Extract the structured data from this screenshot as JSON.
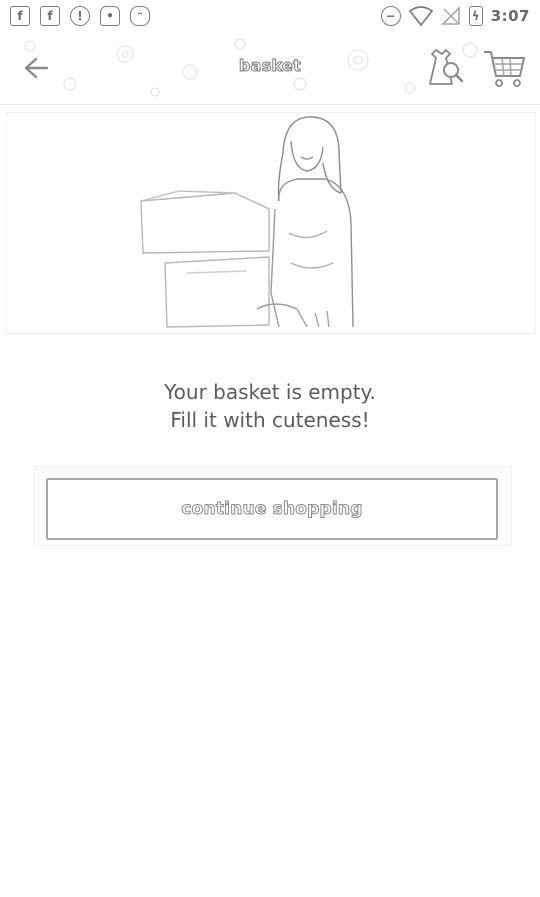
{
  "status_bar": {
    "time": "3:07",
    "icons_left": [
      "facebook-icon",
      "facebook-icon",
      "circle-badge-icon",
      "lock-icon",
      "cat-icon"
    ],
    "icons_right": [
      "do-not-disturb-icon",
      "wifi-icon",
      "no-signal-icon",
      "battery-icon"
    ]
  },
  "header": {
    "title": "basket",
    "back_icon": "arrow-left-icon",
    "search_icon": "dress-search-icon",
    "cart_icon": "shopping-cart-icon"
  },
  "hero": {
    "image": "girl-with-box-illustration"
  },
  "empty_state": {
    "line1": "Your basket is empty.",
    "line2": "Fill it with cuteness!"
  },
  "continue_button": {
    "label": "continue shopping"
  }
}
